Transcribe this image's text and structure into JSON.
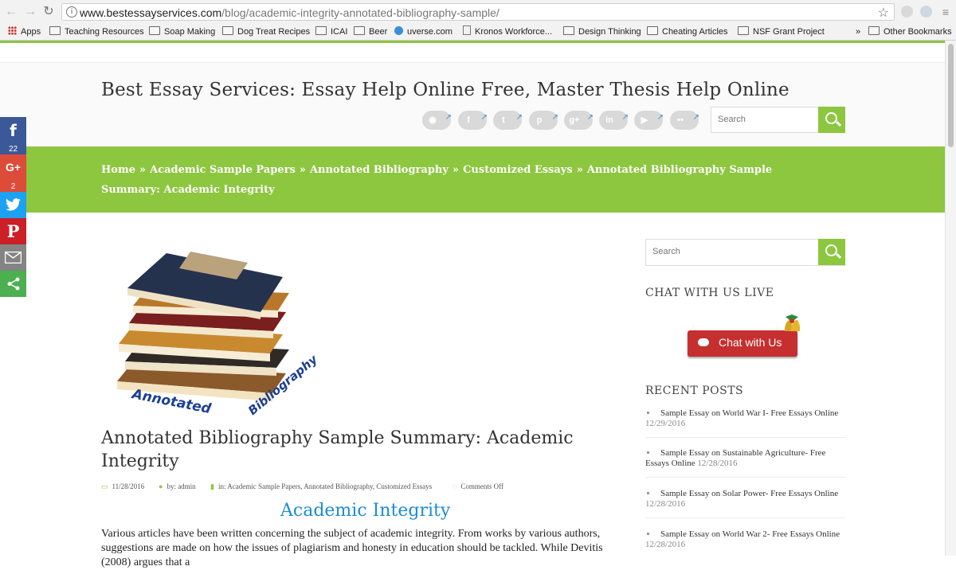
{
  "browser": {
    "url_host": "www.bestessayservices.com",
    "url_path": "/blog/academic-integrity-annotated-bibliography-sample/",
    "bookmarks": [
      {
        "label": "Apps",
        "icon": "apps-grid-icon"
      },
      {
        "label": "Teaching Resources",
        "icon": "folder-icon"
      },
      {
        "label": "Soap Making",
        "icon": "folder-icon"
      },
      {
        "label": "Dog Treat Recipes",
        "icon": "folder-icon"
      },
      {
        "label": "ICAI",
        "icon": "folder-icon"
      },
      {
        "label": "Beer",
        "icon": "folder-icon"
      },
      {
        "label": "uverse.com",
        "icon": "globe-icon"
      },
      {
        "label": "Kronos Workforce...",
        "icon": "document-icon"
      },
      {
        "label": "Design Thinking",
        "icon": "folder-icon"
      },
      {
        "label": "Cheating Articles",
        "icon": "folder-icon"
      },
      {
        "label": "NSF Grant Project",
        "icon": "folder-icon"
      }
    ],
    "overflow_chevron": "»",
    "other_bookmarks": "Other Bookmarks"
  },
  "site": {
    "title": "Best Essay Services: Essay Help Online Free, Master Thesis Help Online",
    "search_placeholder": "Search",
    "accent_color": "#8dc63f",
    "social_icons": [
      "rss-icon",
      "facebook-icon",
      "twitter-icon",
      "pinterest-icon",
      "google-plus-icon",
      "linkedin-icon",
      "youtube-icon",
      "flickr-icon"
    ]
  },
  "breadcrumb": {
    "items": [
      "Home",
      "Academic Sample Papers",
      "Annotated Bibliography",
      "Customized Essays",
      "Annotated Bibliography Sample Summary: Academic Integrity"
    ],
    "separator": "»"
  },
  "share_bar": {
    "facebook_count": "22",
    "google_plus_count": "2"
  },
  "post": {
    "image_word_1": "Annotated",
    "image_word_2": "Bibliography",
    "title": "Annotated Bibliography Sample Summary: Academic Integrity",
    "date": "11/28/2016",
    "author": "by: admin",
    "categories_prefix": "in:",
    "categories": [
      "Academic Sample Papers",
      "Annotated Bibliography",
      "Customized Essays"
    ],
    "comments": "Comments Off",
    "subheading": "Academic Integrity",
    "body": "Various articles have been written concerning the subject of academic integrity. From works by various authors, suggestions are made on how the issues of plagiarism and honesty in education should be tackled. While Devitis (2008) argues that a"
  },
  "sidebar": {
    "search_placeholder": "Search",
    "chat_heading": "CHAT WITH US LIVE",
    "chat_button": "Chat with Us",
    "recent_heading": "RECENT POSTS",
    "recent_posts": [
      {
        "title": "Sample Essay on World War I- Free Essays Online",
        "date": "12/29/2016"
      },
      {
        "title": "Sample Essay on Sustainable Agriculture- Free Essays Online",
        "date": "12/28/2016"
      },
      {
        "title": "Sample Essay on Solar Power- Free Essays Online",
        "date": "12/28/2016"
      },
      {
        "title": "Sample Essay on World War 2- Free Essays Online",
        "date": "12/28/2016"
      }
    ]
  }
}
